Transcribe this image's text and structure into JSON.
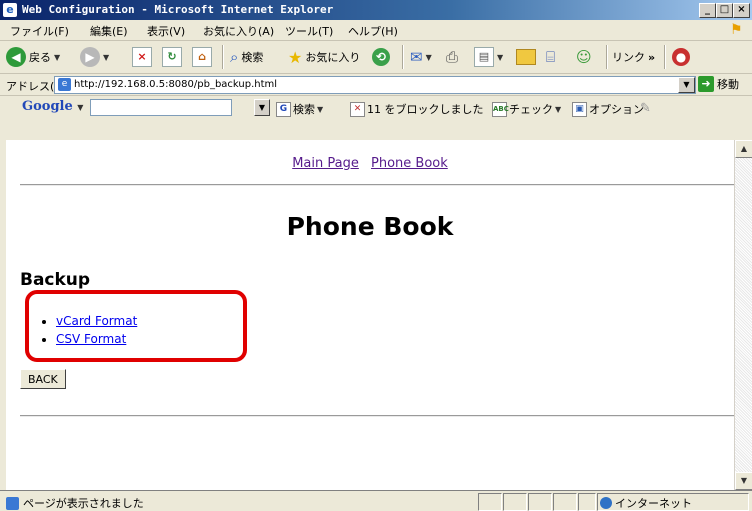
{
  "window": {
    "title": "Web Configuration - Microsoft Internet Explorer"
  },
  "menu": [
    "ファイル(F)",
    "編集(E)",
    "表示(V)",
    "お気に入り(A)",
    "ツール(T)",
    "ヘルプ(H)"
  ],
  "toolbar": {
    "back_label": "戻る",
    "search_label": "検索",
    "favorites_label": "お気に入り",
    "links_label": "リンク",
    "links_more": "»"
  },
  "address": {
    "label": "アドレス(D)",
    "url": "http://192.168.0.5:8080/pb_backup.html",
    "go_label": "移動"
  },
  "google": {
    "logo": "Google",
    "search_label": "検索",
    "blocked_label": "11 をブロックしました",
    "check_label": "チェック",
    "options_label": "オプション"
  },
  "page": {
    "nav_main": "Main Page",
    "nav_phonebook": "Phone Book",
    "heading": "Phone Book",
    "subheading": "Backup",
    "links": [
      "vCard Format",
      "CSV Format"
    ],
    "back_button": "BACK"
  },
  "status": {
    "text": "ページが表示されました",
    "zone": "インターネット"
  }
}
